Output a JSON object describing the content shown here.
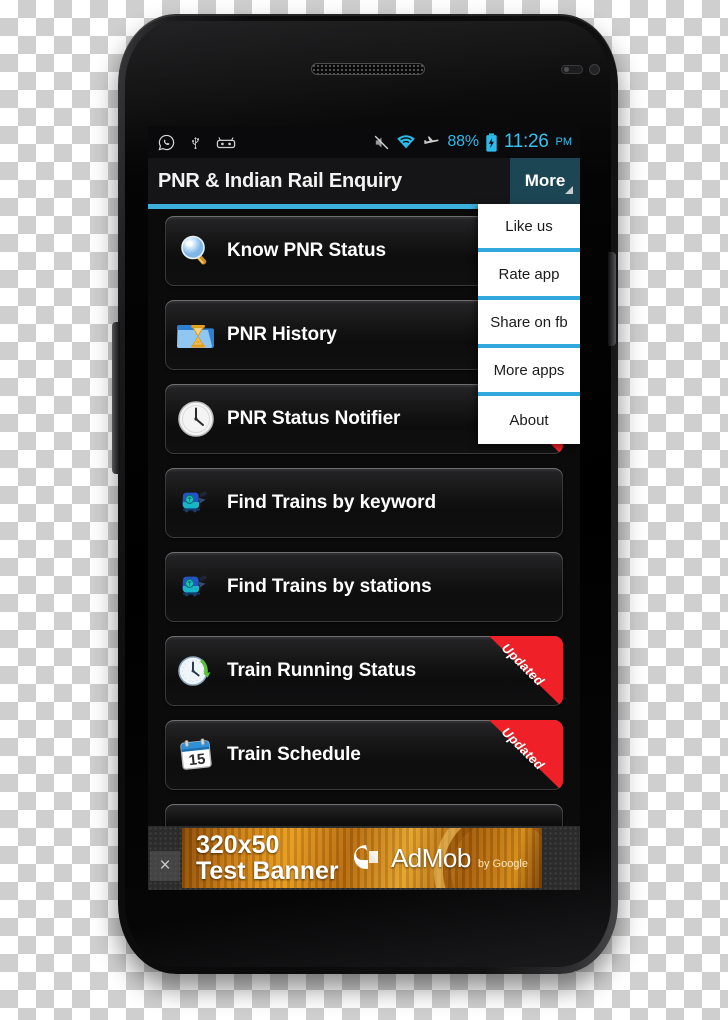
{
  "device": {
    "name": "android-phone-mockup",
    "hardware": {
      "earpiece": "earpiece-speaker",
      "proximity_sensor": "proximity-sensor",
      "light_sensor": "light-sensor",
      "front_camera": "front-camera",
      "volume_key": "volume-rocker",
      "power_key": "power-button"
    }
  },
  "statusbar": {
    "left_icons": [
      "whatsapp-icon",
      "usb-icon",
      "android-head-icon"
    ],
    "right_icons": [
      "mute-icon",
      "wifi-icon",
      "airplane-mode-icon",
      "battery-charging-icon"
    ],
    "battery": "88%",
    "time": "11:26",
    "ampm": "PM",
    "accent_color": "#2eb8e6",
    "background_color": "#0a0a0c"
  },
  "titlebar": {
    "title": "PNR & Indian Rail Enquiry",
    "more_label": "More",
    "more_caret": "caret-down-icon",
    "more_bg_color": "#1d4654",
    "underline_color": "#3bb0dd",
    "background_color": "#151517"
  },
  "menu": {
    "visible": true,
    "separator_color": "#2fa8de",
    "items": [
      {
        "label": "Like us",
        "name": "menu-item-like-us"
      },
      {
        "label": "Rate app",
        "name": "menu-item-rate-app"
      },
      {
        "label": "Share on fb",
        "name": "menu-item-share-on-fb"
      },
      {
        "label": "More apps",
        "name": "menu-item-more-apps"
      },
      {
        "label": "About",
        "name": "menu-item-about"
      }
    ]
  },
  "list": {
    "ribbon_label": "Updated",
    "ribbon_color": "#ef2027",
    "items": [
      {
        "label": "Know PNR Status",
        "icon": "magnifier-icon",
        "ribbon": false
      },
      {
        "label": "PNR History",
        "icon": "folder-hourglass-icon",
        "ribbon": false
      },
      {
        "label": "PNR Status Notifier",
        "icon": "clock-icon",
        "ribbon": true
      },
      {
        "label": "Find Trains by keyword",
        "icon": "train-icon",
        "ribbon": false
      },
      {
        "label": "Find Trains by stations",
        "icon": "train-icon",
        "ribbon": false
      },
      {
        "label": "Train Running Status",
        "icon": "clock-refresh-icon",
        "ribbon": true
      },
      {
        "label": "Train Schedule",
        "icon": "calendar-15-icon",
        "ribbon": true
      }
    ]
  },
  "ad": {
    "close_label": "×",
    "size_text": "320x50",
    "sub_text": "Test Banner",
    "brand": "AdMob",
    "brand_by": "by Google",
    "brand_mark": "admob-logo-icon"
  }
}
